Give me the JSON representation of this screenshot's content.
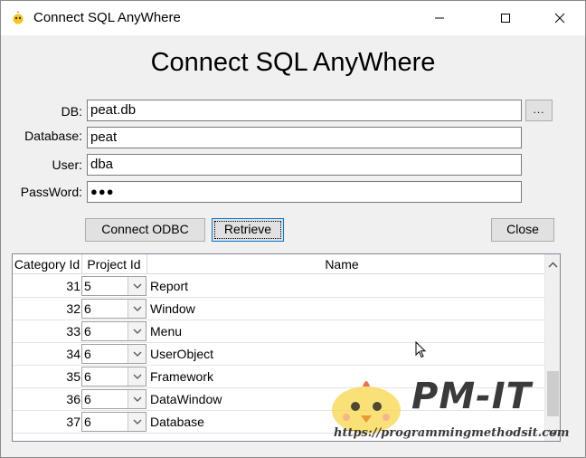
{
  "window": {
    "title": "Connect SQL AnyWhere",
    "controls": {
      "minimize": "—",
      "maximize": "☐",
      "close": "✕"
    }
  },
  "heading": "Connect SQL AnyWhere",
  "form": {
    "db_label": "DB:",
    "db_value": "peat.db",
    "browse_label": "...",
    "database_label": "Database:",
    "database_value": "peat",
    "user_label": "User:",
    "user_value": "dba",
    "password_label": "PassWord:",
    "password_value": "●●●"
  },
  "buttons": {
    "connect": "Connect ODBC",
    "retrieve": "Retrieve",
    "close": "Close"
  },
  "grid": {
    "columns": [
      "Category Id",
      "Project Id",
      "Name"
    ],
    "rows": [
      {
        "category_id": "31",
        "project_id": "5",
        "name": "Report"
      },
      {
        "category_id": "32",
        "project_id": "6",
        "name": "Window"
      },
      {
        "category_id": "33",
        "project_id": "6",
        "name": "Menu"
      },
      {
        "category_id": "34",
        "project_id": "6",
        "name": "UserObject"
      },
      {
        "category_id": "35",
        "project_id": "6",
        "name": "Framework"
      },
      {
        "category_id": "36",
        "project_id": "6",
        "name": "DataWindow"
      },
      {
        "category_id": "37",
        "project_id": "6",
        "name": "Database"
      }
    ]
  },
  "watermark": {
    "brand": "PM-IT",
    "url": "https://programmingmethodsit.com"
  },
  "colors": {
    "window_bg": "#f0f0f0",
    "focus_border": "#0078d7"
  }
}
